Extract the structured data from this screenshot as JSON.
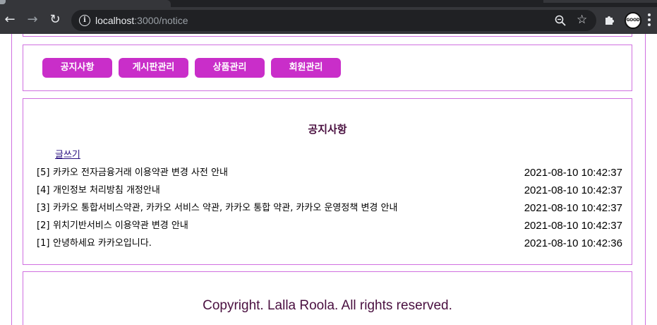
{
  "browser": {
    "url_host": "localhost",
    "url_rest": ":3000/notice",
    "profile_label": "GOOD"
  },
  "nav": {
    "items": [
      {
        "label": "공지사항"
      },
      {
        "label": "게시판관리"
      },
      {
        "label": "상품관리"
      },
      {
        "label": "회원관리"
      }
    ]
  },
  "notice": {
    "title": "공지사항",
    "write_link": "글쓰기",
    "rows": [
      {
        "num": "[5]",
        "title": "카카오 전자금융거래 이용약관 변경 사전 안내",
        "date": "2021-08-10 10:42:37"
      },
      {
        "num": "[4]",
        "title": "개인정보 처리방침 개정안내",
        "date": "2021-08-10 10:42:37"
      },
      {
        "num": "[3]",
        "title": "카카오 통합서비스약관, 카카오 서비스 약관, 카카오 통합 약관, 카카오 운영정책 변경 안내",
        "date": "2021-08-10 10:42:37"
      },
      {
        "num": "[2]",
        "title": "위치기반서비스 이용약관 변경 안내",
        "date": "2021-08-10 10:42:37"
      },
      {
        "num": "[1]",
        "title": "안녕하세요 카카오입니다.",
        "date": "2021-08-10 10:42:36"
      }
    ]
  },
  "footer": {
    "text": "Copyright. Lalla Roola. All rights reserved."
  },
  "colors": {
    "accent": "#c92ec9",
    "border": "#d070e0",
    "title_text": "#4a1040",
    "link": "#2a1080"
  }
}
